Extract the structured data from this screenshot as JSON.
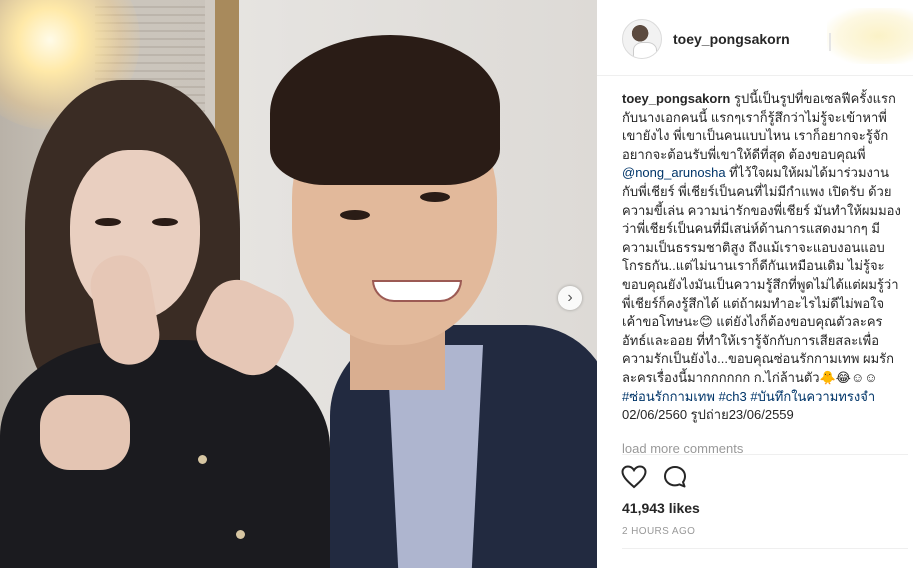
{
  "post": {
    "username": "toey_pongsakorn",
    "caption": {
      "user": "toey_pongsakorn",
      "segments": [
        {
          "type": "text",
          "value": " รูปนี้เป็นรูปที่ขอเซลฟีครั้งแรกกับนางเอกคนนี้ แรกๆเราก็รู้สึกว่าไม่รู้จะเข้าหาพี่เขายังไง พี่เขาเป็นคนแบบไหน เราก็อยากจะรู้จักอยากจะต้อนรับพี่เขาให้ดีที่สุด ต้องขอบคุณพี่ "
        },
        {
          "type": "tag",
          "value": "@nong_arunosha"
        },
        {
          "type": "text",
          "value": " ที่ไว้ใจผมให้ผมได้มาร่วมงานกับพี่เชียร์ พี่เชียร์เป็นคนที่ไม่มีกำแพง เปิดรับ ด้วยความขี้เล่น ความน่ารักของพี่เชียร์ มันทำให้ผมมองว่าพี่เชียร์เป็นคนที่มีเสน่ห์ด้านการแสดงมากๆ มีความเป็นธรรมชาติสูง ถึงแม้เราจะแอบงอนแอบโกรธกัน..แต่ไม่นานเราก็ดีกันเหมือนเดิม ไม่รู้จะขอบคุณยังไงมันเป็นความรู้สึกที่พูดไม่ได้แต่ผมรู้ว่าพี่เชียร์ก็คงรู้สึกได้ แต่ถ้าผมทำอะไรไม่ดีไม่พอใจ เค้าขอโทษนะ😊 แต่ยังไงก็ต้องขอบคุณตัวละครอัทธ์และออย ที่ทำให้เรารู้จักกับการเสียสละเพื่อความรักเป็นยังไง...ขอบคุณซ่อนรักกามเทพ ผมรักละครเรื่องนี้มากกกกกก ก.ไก่ล้านตัว🐥😂☺☺ "
        },
        {
          "type": "tag",
          "value": "#ซ่อนรักกามเทพ"
        },
        {
          "type": "text",
          "value": " "
        },
        {
          "type": "tag",
          "value": "#ch3"
        },
        {
          "type": "text",
          "value": " "
        },
        {
          "type": "tag",
          "value": "#บันทึกในความทรงจำ"
        },
        {
          "type": "text",
          "value": " 02/06/2560 รูปถ่าย23/06/2559"
        }
      ]
    },
    "load_more": "load more comments",
    "likes": "41,943 likes",
    "time": "2 HOURS AGO"
  },
  "icons": {
    "heart": "heart-icon",
    "comment": "comment-icon",
    "next": "chevron-right-icon"
  },
  "colors": {
    "tag": "#003569",
    "muted": "#999999",
    "text": "#262626"
  }
}
